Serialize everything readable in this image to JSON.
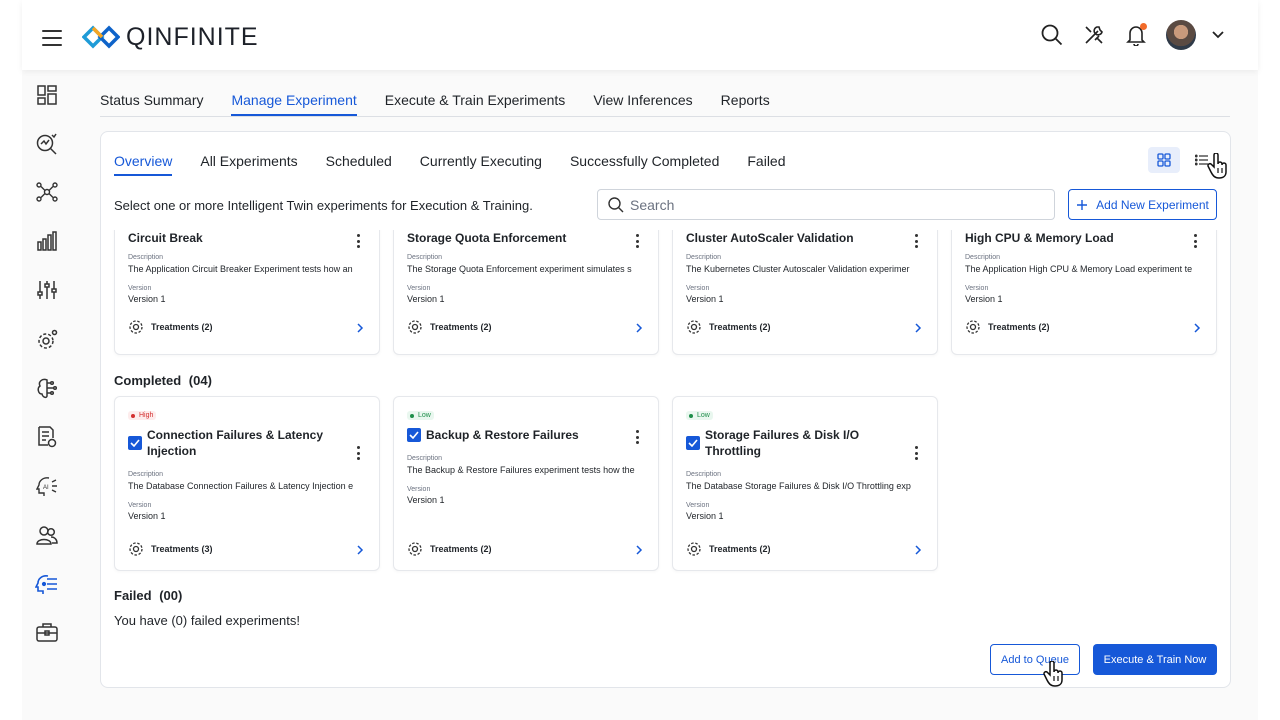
{
  "app": {
    "brand": "QINFINITE",
    "accent": "#1658d8"
  },
  "top_icons": [
    "search-icon",
    "tools-icon",
    "bell-icon",
    "avatar",
    "chevron-down-icon"
  ],
  "sidebar": {
    "items": [
      "dashboard-icon",
      "search-analytics-icon",
      "network-icon",
      "bar-chart-icon",
      "sliders-icon",
      "gear-settings-icon",
      "brain-icon",
      "document-icon",
      "ai-icon",
      "users-icon",
      "experiment-icon",
      "briefcase-icon"
    ],
    "active": "experiment-icon"
  },
  "main_tabs": [
    {
      "label": "Status Summary"
    },
    {
      "label": "Manage Experiment",
      "active": true
    },
    {
      "label": "Execute & Train Experiments"
    },
    {
      "label": "View Inferences"
    },
    {
      "label": "Reports"
    }
  ],
  "sub_tabs": [
    {
      "label": "Overview",
      "active": true
    },
    {
      "label": "All Experiments"
    },
    {
      "label": "Scheduled"
    },
    {
      "label": "Currently Executing"
    },
    {
      "label": "Successfully Completed"
    },
    {
      "label": "Failed"
    }
  ],
  "instruction": "Select one or more Intelligent Twin experiments for Execution & Training.",
  "search": {
    "placeholder": "Search"
  },
  "add_button": "Add New Experiment",
  "labels": {
    "description": "Description",
    "version": "Version"
  },
  "top_cards": [
    {
      "title": "Circuit Break",
      "description": "The Application Circuit Breaker Experiment tests how an",
      "version": "Version 1",
      "treatments": "Treatments (2)"
    },
    {
      "title": "Storage Quota Enforcement",
      "description": "The Storage Quota Enforcement experiment simulates s",
      "version": "Version 1",
      "treatments": "Treatments (2)"
    },
    {
      "title": "Cluster AutoScaler Validation",
      "description": "The Kubernetes Cluster Autoscaler Validation experimer",
      "version": "Version 1",
      "treatments": "Treatments (2)"
    },
    {
      "title": "High CPU & Memory Load",
      "description": "The Application High CPU & Memory Load experiment te",
      "version": "Version 1",
      "treatments": "Treatments (2)"
    }
  ],
  "completed": {
    "heading": "Completed",
    "count": "(04)",
    "cards": [
      {
        "priority": "High",
        "title": "Connection Failures & Latency Injection",
        "description": "The Database Connection Failures & Latency Injection e",
        "version": "Version 1",
        "treatments": "Treatments (3)"
      },
      {
        "priority": "Low",
        "title": "Backup & Restore Failures",
        "description": "The Backup & Restore Failures experiment tests how the",
        "version": "Version 1",
        "treatments": "Treatments (2)"
      },
      {
        "priority": "Low",
        "title": "Storage Failures & Disk I/O Throttling",
        "description": "The Database Storage Failures & Disk I/O Throttling exp",
        "version": "Version 1",
        "treatments": "Treatments (2)"
      }
    ]
  },
  "failed": {
    "heading": "Failed",
    "count": "(00)",
    "message": "You have (0) failed experiments!"
  },
  "actions": {
    "queue": "Add to Queue",
    "execute": "Execute & Train Now"
  }
}
